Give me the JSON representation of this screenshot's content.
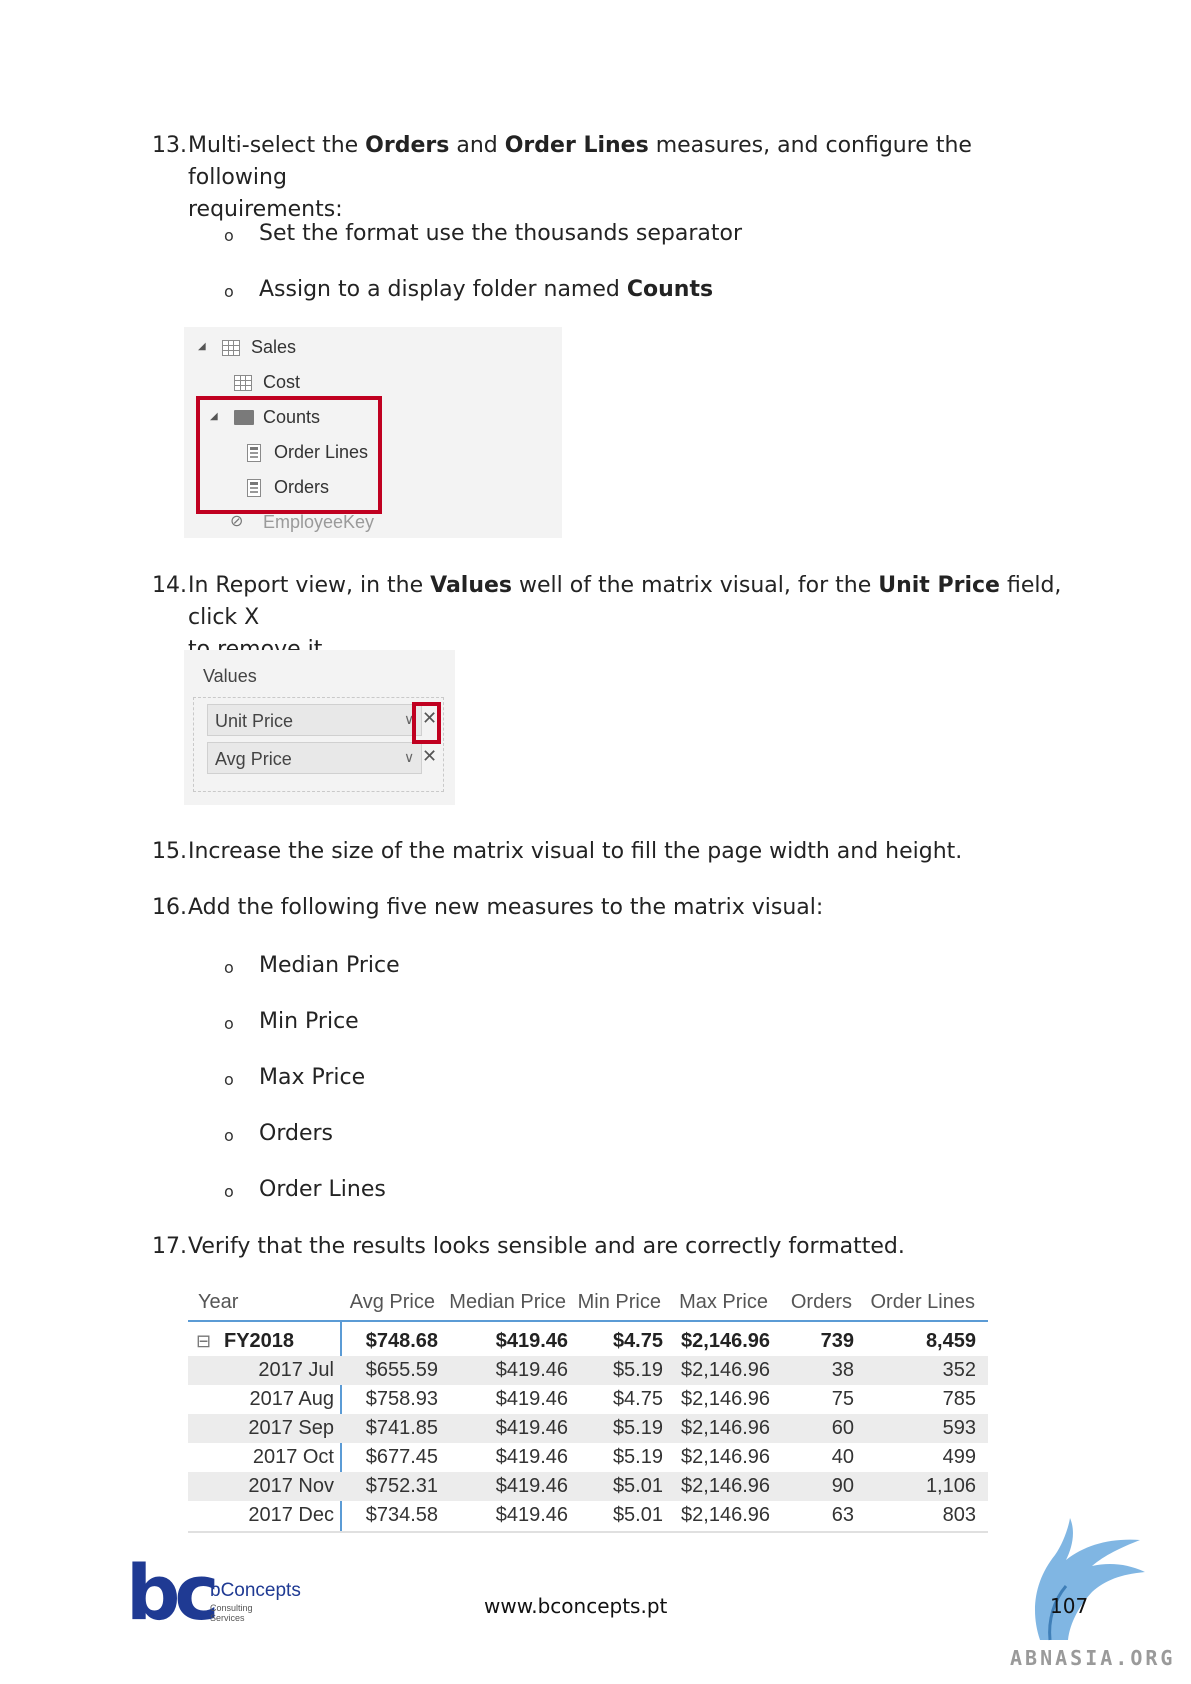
{
  "steps": {
    "s13": {
      "num": "13.",
      "line1_pre": "Multi-select the ",
      "line1_b1": "Orders",
      "line1_mid": " and ",
      "line1_b2": "Order Lines",
      "line1_post": " measures, and configure the following",
      "line2": "requirements:",
      "bullets": [
        {
          "text": "Set the format use the thousands separator"
        },
        {
          "pre": "Assign to a display folder named ",
          "bold": "Counts"
        }
      ]
    },
    "s14": {
      "num": "14.",
      "line1_pre": "In Report view, in the ",
      "line1_b1": "Values",
      "line1_mid": " well of the matrix visual, for the ",
      "line1_b2": "Unit Price",
      "line1_post": " field, click X",
      "line2": "to remove it."
    },
    "s15": {
      "num": "15.",
      "text": "Increase the size of the matrix visual to fill the page width and height."
    },
    "s16": {
      "num": "16.",
      "text": "Add the following five new measures to the matrix visual:",
      "bullets": [
        "Median Price",
        "Min Price",
        "Max Price",
        "Orders",
        "Order Lines"
      ]
    },
    "s17": {
      "num": "17.",
      "text": "Verify that the results looks sensible and are correctly formatted."
    }
  },
  "bullet_glyph": "o",
  "field_list": {
    "table": "Sales",
    "items": {
      "cost": "Cost",
      "folder": "Counts",
      "order_lines": "Order Lines",
      "orders": "Orders",
      "hidden": "EmployeeKey"
    }
  },
  "values_well": {
    "title": "Values",
    "fields": [
      "Unit Price",
      "Avg Price"
    ],
    "remove_glyph": "✕",
    "chevron_glyph": "∨"
  },
  "matrix": {
    "headers": [
      "Year",
      "Avg Price",
      "Median Price",
      "Min Price",
      "Max Price",
      "Orders",
      "Order Lines"
    ],
    "expand_glyph": "⊟",
    "total_row": [
      "FY2018",
      "$748.68",
      "$419.46",
      "$4.75",
      "$2,146.96",
      "739",
      "8,459"
    ],
    "rows": [
      [
        "2017 Jul",
        "$655.59",
        "$419.46",
        "$5.19",
        "$2,146.96",
        "38",
        "352"
      ],
      [
        "2017 Aug",
        "$758.93",
        "$419.46",
        "$4.75",
        "$2,146.96",
        "75",
        "785"
      ],
      [
        "2017 Sep",
        "$741.85",
        "$419.46",
        "$5.19",
        "$2,146.96",
        "60",
        "593"
      ],
      [
        "2017 Oct",
        "$677.45",
        "$419.46",
        "$5.19",
        "$2,146.96",
        "40",
        "499"
      ],
      [
        "2017 Nov",
        "$752.31",
        "$419.46",
        "$5.01",
        "$2,146.96",
        "90",
        "1,106"
      ],
      [
        "2017 Dec",
        "$734.58",
        "$419.46",
        "$5.01",
        "$2,146.96",
        "63",
        "803"
      ]
    ]
  },
  "footer": {
    "logo_letters": "bc",
    "brand": "bConcepts",
    "tag1": "Consulting",
    "tag2": "Services",
    "url": "www.bconcepts.pt",
    "page": "107",
    "watermark": "ABNASIA.ORG"
  },
  "colors": {
    "highlight": "#c00020",
    "matrix_rule": "#5b9bd5",
    "logo_blue": "#1f3a93",
    "watermark_blue": "#6aa9de"
  }
}
